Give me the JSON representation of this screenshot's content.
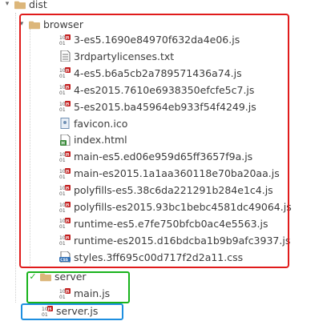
{
  "tree": {
    "root": {
      "label": "dist"
    },
    "browser": {
      "label": "browser",
      "files": [
        {
          "name": "3-es5.1690e84970f632da4e06.js",
          "icon": "js-file-icon"
        },
        {
          "name": "3rdpartylicenses.txt",
          "icon": "text-file-icon"
        },
        {
          "name": "4-es5.b6a5cb2a789571436a74.js",
          "icon": "js-file-icon"
        },
        {
          "name": "4-es2015.7610e6938350efcfe5c7.js",
          "icon": "js-file-icon"
        },
        {
          "name": "5-es2015.ba45964eb933f54f4249.js",
          "icon": "js-file-icon"
        },
        {
          "name": "favicon.ico",
          "icon": "image-file-icon"
        },
        {
          "name": "index.html",
          "icon": "html-file-icon"
        },
        {
          "name": "main-es5.ed06e959d65ff3657f9a.js",
          "icon": "js-file-icon"
        },
        {
          "name": "main-es2015.1a1aa360118e70ba20aa.js",
          "icon": "js-file-icon"
        },
        {
          "name": "polyfills-es5.38c6da221291b284e1c4.js",
          "icon": "js-file-icon"
        },
        {
          "name": "polyfills-es2015.93bc1bebc4581dc49064.js",
          "icon": "js-file-icon"
        },
        {
          "name": "runtime-es5.e7fe750bfcb0ac4e5563.js",
          "icon": "js-file-icon"
        },
        {
          "name": "runtime-es2015.d16bdcba1b9b9afc3937.js",
          "icon": "js-file-icon"
        },
        {
          "name": "styles.3ff695c00d717f2d2a11.css",
          "icon": "css-file-icon"
        }
      ]
    },
    "server": {
      "label": "server",
      "files": [
        {
          "name": "main.js",
          "icon": "js-file-icon"
        }
      ]
    },
    "root_files": [
      {
        "name": "server.js",
        "icon": "js-file-icon"
      }
    ]
  },
  "colors": {
    "folder": "#dcb67a",
    "highlight_red": "#e01b1b",
    "highlight_green": "#19b31c",
    "highlight_blue": "#1e8fe0",
    "js_badge": "#c21f1f",
    "html_badge": "#3a8a3a",
    "css_badge": "#2f6fb5"
  }
}
